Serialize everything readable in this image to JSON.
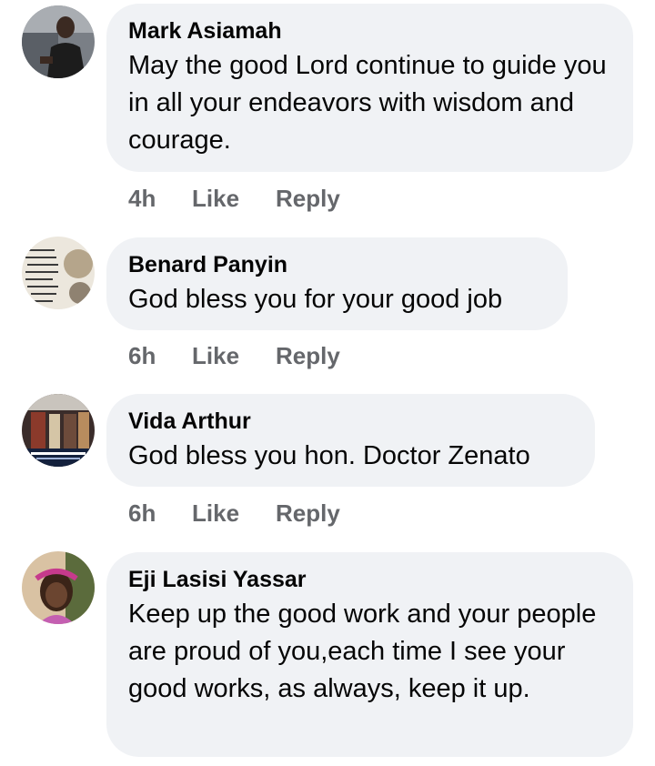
{
  "comments": [
    {
      "author": "Mark Asiamah",
      "text": "May the good Lord continue to guide you in all your endeavors with wisdom and courage.",
      "time": "4h",
      "like_label": "Like",
      "reply_label": "Reply"
    },
    {
      "author": "Benard Panyin",
      "text": "God bless you for your good job",
      "time": "6h",
      "like_label": "Like",
      "reply_label": "Reply"
    },
    {
      "author": "Vida Arthur",
      "text": "God bless you hon. Doctor Zenato",
      "time": "6h",
      "like_label": "Like",
      "reply_label": "Reply"
    },
    {
      "author": "Eji Lasisi Yassar",
      "text": "Keep up the good work and  your people are proud of you,each time I see your good works, as always, keep it up.",
      "time": "",
      "like_label": "",
      "reply_label": ""
    }
  ],
  "colors": {
    "bubble_bg": "#f0f2f5",
    "secondary_text": "#65676b",
    "primary_text": "#050505"
  },
  "icons": {
    "avatar_1": "profile-photo-man",
    "avatar_2": "profile-photo-quote-image",
    "avatar_3": "profile-photo-group-event",
    "avatar_4": "profile-photo-girl"
  }
}
